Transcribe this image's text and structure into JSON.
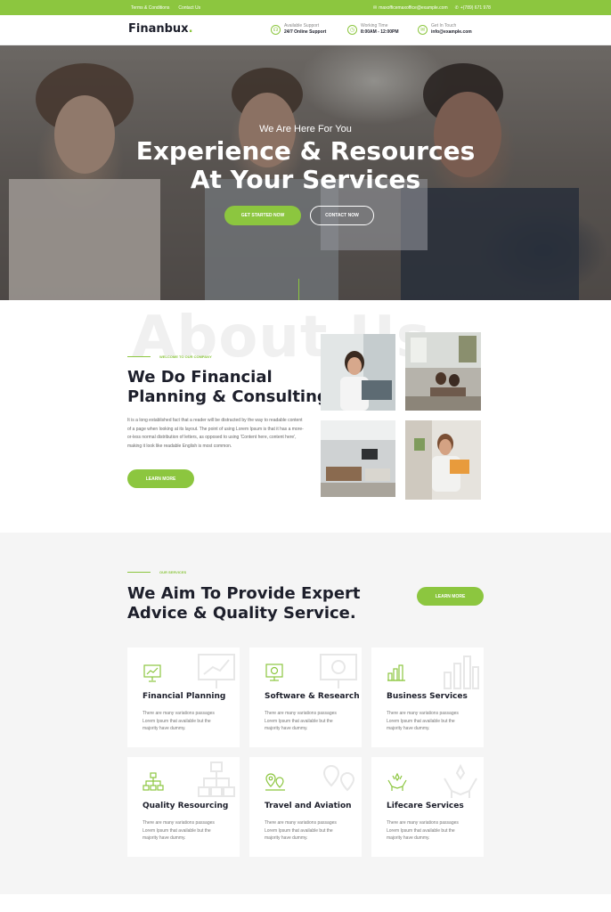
{
  "topbar": {
    "links": [
      "Terms & Conditions",
      "Contact Us"
    ],
    "email": "maxofficemaxoffice@example.com",
    "phone": "+(789) 671 978"
  },
  "header": {
    "logo": "Finanbux",
    "logo_dot": ".",
    "support_label": "Available Support",
    "support_value": "24/7 Online Support",
    "time_label": "Working Time",
    "time_value": "8:00AM - 12:00PM",
    "touch_label": "Get In Touch",
    "touch_value": "info@example.com"
  },
  "hero": {
    "subtitle": "We Are Here For You",
    "title_line1": "Experience & Resources",
    "title_line2": "At Your Services",
    "btn_primary": "GET STARTED NOW",
    "btn_secondary": "CONTACT NOW"
  },
  "about": {
    "watermark": "About Us",
    "tagline": "WELCOME TO OUR COMPANY",
    "title_line1": "We Do Financial",
    "title_line2": "Planning & Consulting",
    "text": "It is a long established fact that a reader will be distracted by the way to readable content of a page when looking at its layout. The point of using Lorem Ipsum is that it has a more-or-less normal distribution of letters, as opposed to using 'Content here, content here', making it look like readable English is most common.",
    "button": "LEARN MORE"
  },
  "services": {
    "tagline": "OUR SERVICES",
    "title_line1": "We Aim To Provide Expert",
    "title_line2": "Advice & Quality Service.",
    "button": "LEARN MORE",
    "cards": [
      {
        "title": "Financial Planning",
        "desc": "There are many variations passages Lorem Ipsum that available but the majority have dummy.",
        "icon": "presentation-chart-icon"
      },
      {
        "title": "Software & Research",
        "desc": "There are many variations passages Lorem Ipsum that available but the majority have dummy.",
        "icon": "monitor-research-icon"
      },
      {
        "title": "Business Services",
        "desc": "There are many variations passages Lorem Ipsum that available but the majority have dummy.",
        "icon": "bar-chart-icon"
      },
      {
        "title": "Quality Resourcing",
        "desc": "There are many variations passages Lorem Ipsum that available but the majority have dummy.",
        "icon": "org-chart-icon"
      },
      {
        "title": "Travel and Aviation",
        "desc": "There are many variations passages Lorem Ipsum that available but the majority have dummy.",
        "icon": "map-pin-icon"
      },
      {
        "title": "Lifecare Services",
        "desc": "There are many variations passages Lorem Ipsum that available but the majority have dummy.",
        "icon": "hands-care-icon"
      }
    ]
  },
  "colors": {
    "accent": "#8cc63f",
    "dark": "#1d1f2b",
    "muted_bg": "#f5f5f5"
  }
}
